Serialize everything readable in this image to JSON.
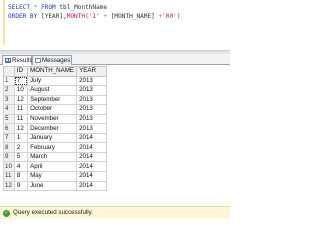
{
  "query": {
    "line1": {
      "kw1": "SELECT",
      "star": "*",
      "kw2": "FROM",
      "table": "tbl_MonthName"
    },
    "line2": {
      "kw1": "ORDER BY",
      "col1": "[YEAR],",
      "fn": "MONTH",
      "lit": "('1'",
      "plus": "+",
      "col2": "[MONTH_NAME]",
      "plus2": "+",
      "lit2": "'00')"
    }
  },
  "tabs": {
    "results": "Results",
    "messages": "Messages"
  },
  "grid": {
    "columns": [
      "ID",
      "MONTH_NAME",
      "YEAR"
    ],
    "rows": [
      {
        "n": "1",
        "id": "7",
        "month": "July",
        "year": "2013"
      },
      {
        "n": "2",
        "id": "10",
        "month": "August",
        "year": "2013"
      },
      {
        "n": "3",
        "id": "12",
        "month": "September",
        "year": "2013"
      },
      {
        "n": "4",
        "id": "11",
        "month": "October",
        "year": "2013"
      },
      {
        "n": "5",
        "id": "11",
        "month": "November",
        "year": "2013"
      },
      {
        "n": "6",
        "id": "12",
        "month": "December",
        "year": "2013"
      },
      {
        "n": "7",
        "id": "1",
        "month": "January",
        "year": "2014"
      },
      {
        "n": "8",
        "id": "2",
        "month": "February",
        "year": "2014"
      },
      {
        "n": "9",
        "id": "5",
        "month": "March",
        "year": "2014"
      },
      {
        "n": "10",
        "id": "4",
        "month": "April",
        "year": "2014"
      },
      {
        "n": "11",
        "id": "8",
        "month": "May",
        "year": "2014"
      },
      {
        "n": "12",
        "id": "9",
        "month": "June",
        "year": "2014"
      }
    ]
  },
  "status": {
    "icon_glyph": "✓",
    "text": "Query executed successfully."
  }
}
